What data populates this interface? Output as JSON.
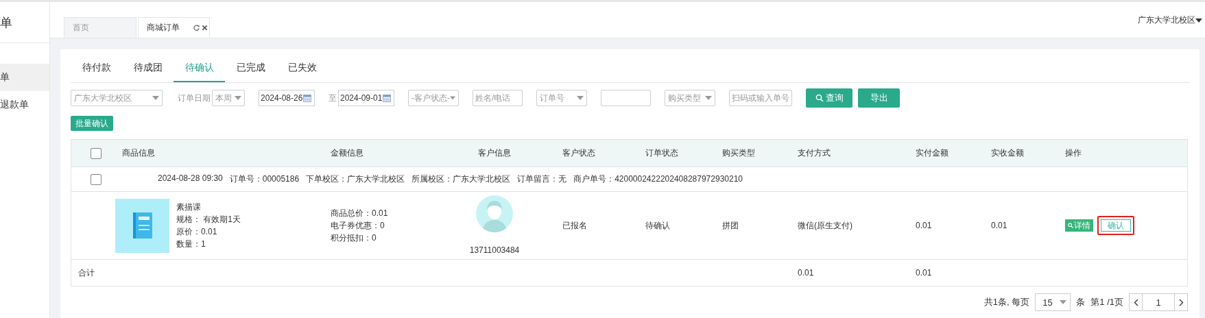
{
  "sidebar": {
    "title": "单",
    "items": [
      {
        "label": "单",
        "selected": true
      },
      {
        "label": "退款单",
        "selected": false
      }
    ]
  },
  "page_tabs": [
    {
      "label": "首页",
      "selected": false,
      "closable": false
    },
    {
      "label": "商城订单",
      "selected": true,
      "closable": true
    }
  ],
  "campus_menu": "广东大学北校区",
  "status_tabs": [
    {
      "label": "待付款",
      "selected": false
    },
    {
      "label": "待成团",
      "selected": false
    },
    {
      "label": "待确认",
      "selected": true
    },
    {
      "label": "已完成",
      "selected": false
    },
    {
      "label": "已失效",
      "selected": false
    }
  ],
  "filters": [
    {
      "kind": "select",
      "value": "广东大学北校区"
    },
    {
      "kind": "label",
      "text": "订单日期"
    },
    {
      "kind": "select",
      "value": "本周"
    },
    {
      "kind": "date",
      "value": "2024-08-26"
    },
    {
      "kind": "label",
      "text": "至"
    },
    {
      "kind": "date",
      "value": "2024-09-01"
    },
    {
      "kind": "select",
      "value": "-客户状态-"
    },
    {
      "kind": "input",
      "placeholder": "姓名/电话"
    },
    {
      "kind": "select",
      "value": "订单号"
    },
    {
      "kind": "input"
    },
    {
      "kind": "select",
      "value": "购买类型"
    },
    {
      "kind": "input",
      "placeholder": "扫码或输入单号"
    }
  ],
  "buttons": [
    {
      "label": "查询",
      "kind": "search"
    },
    {
      "label": "导出",
      "kind": "plain"
    }
  ],
  "batch_button": "批量确认",
  "table": {
    "header_checked": false,
    "columns": [
      "商品信息",
      "金额信息",
      "客户信息",
      "客户状态",
      "订单状态",
      "购买类型",
      "支付方式",
      "实付金额",
      "实收金额",
      "操作"
    ],
    "orders": [
      {
        "checked": false,
        "summary": [
          "2024-08-28 09:30",
          "订单号：00005186",
          "下单校区：广东大学北校区",
          "所属校区：广东大学北校区",
          "订单留言：无",
          "商户单号：4200002422202408287972930210"
        ],
        "product": {
          "name": "素描课",
          "lines": [
            "规格： 有效期1天",
            "原价：0.01",
            "数量：1"
          ]
        },
        "amounts": [
          "商品总价：0.01",
          "电子券优惠：0",
          "积分抵扣：0"
        ],
        "phone": "13711003484",
        "customer_status": "已报名",
        "order_status": "待确认",
        "purchase_type": "拼团",
        "payment": "微信(原生支付)",
        "paid": "0.01",
        "received": "0.01",
        "actions": [
          {
            "label": "详情",
            "kind": "detail"
          },
          {
            "label": "确认",
            "kind": "confirm",
            "highlighted": true
          }
        ]
      }
    ],
    "total": {
      "label": "合计",
      "payment": "0.01",
      "paid": "0.01"
    }
  },
  "pagination": {
    "summary": "共1条, 每页",
    "page_size": "15",
    "unit": "条",
    "page_info": "第1 /1页",
    "page": "1"
  }
}
